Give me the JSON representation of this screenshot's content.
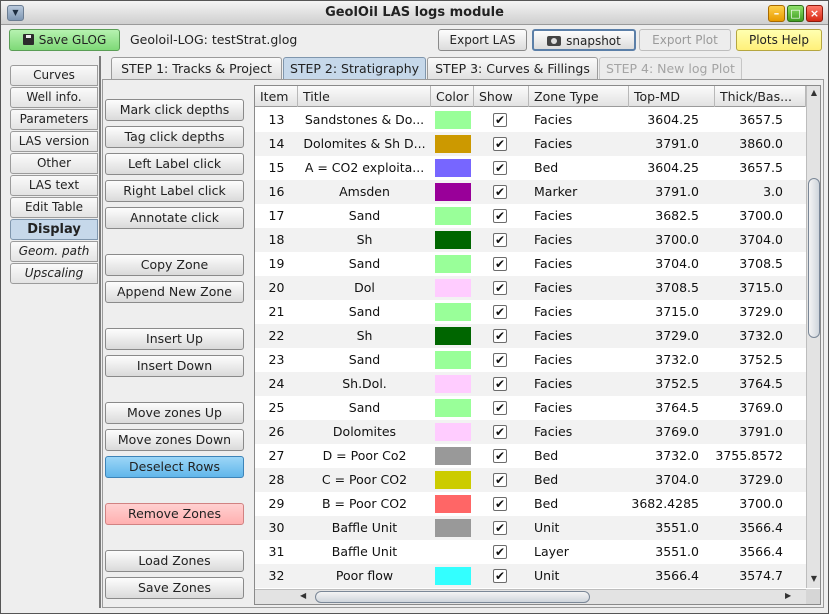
{
  "window": {
    "title": "GeolOil LAS logs module"
  },
  "toolbar": {
    "save_glog": "Save GLOG",
    "file_label": "Geoloil-LOG: testStrat.glog",
    "export_las": "Export LAS",
    "snapshot": "snapshot",
    "export_plot": "Export Plot",
    "plots_help": "Plots Help"
  },
  "side_tabs": [
    {
      "label": "Curves"
    },
    {
      "label": "Well info."
    },
    {
      "label": "Parameters"
    },
    {
      "label": "LAS version"
    },
    {
      "label": "Other"
    },
    {
      "label": "LAS text"
    },
    {
      "label": "Edit Table"
    },
    {
      "label": "Display",
      "active": true
    },
    {
      "label": "Geom. path",
      "italic": true
    },
    {
      "label": "Upscaling",
      "italic": true
    }
  ],
  "top_tabs": [
    {
      "label": "STEP 1: Tracks & Project"
    },
    {
      "label": "STEP 2: Stratigraphy",
      "active": true
    },
    {
      "label": "STEP 3: Curves & Fillings"
    },
    {
      "label": "STEP 4: New log Plot",
      "disabled": true
    }
  ],
  "actions": {
    "mark_click_depths": "Mark click depths",
    "tag_click_depths": "Tag click depths",
    "left_label_click": "Left Label click",
    "right_label_click": "Right Label click",
    "annotate_click": "Annotate click",
    "copy_zone": "Copy Zone",
    "append_new_zone": "Append New Zone",
    "insert_up": "Insert Up",
    "insert_down": "Insert Down",
    "move_zones_up": "Move zones Up",
    "move_zones_down": "Move zones Down",
    "deselect_rows": "Deselect Rows",
    "remove_zones": "Remove Zones",
    "load_zones": "Load Zones",
    "save_zones": "Save Zones"
  },
  "table": {
    "columns": [
      "Item",
      "Title",
      "Color",
      "Show",
      "Zone Type",
      "Top-MD",
      "Thick/Bas..."
    ],
    "rows": [
      {
        "item": "13",
        "title": "Sandstones & Do...",
        "color": "#99ff99",
        "show": "✔",
        "type": "Facies",
        "top": "3604.25",
        "thick": "3657.5"
      },
      {
        "item": "14",
        "title": "Dolomites & Sh D...",
        "color": "#cc9900",
        "show": "✔",
        "type": "Facies",
        "top": "3791.0",
        "thick": "3860.0"
      },
      {
        "item": "15",
        "title": "A = CO2 exploita...",
        "color": "#7766ff",
        "show": "✔",
        "type": "Bed",
        "top": "3604.25",
        "thick": "3657.5"
      },
      {
        "item": "16",
        "title": "Amsden",
        "color": "#990099",
        "show": "✔",
        "type": "Marker",
        "top": "3791.0",
        "thick": "3.0"
      },
      {
        "item": "17",
        "title": "Sand",
        "color": "#99ff99",
        "show": "✔",
        "type": "Facies",
        "top": "3682.5",
        "thick": "3700.0"
      },
      {
        "item": "18",
        "title": "Sh",
        "color": "#006600",
        "show": "✔",
        "type": "Facies",
        "top": "3700.0",
        "thick": "3704.0"
      },
      {
        "item": "19",
        "title": "Sand",
        "color": "#99ff99",
        "show": "✔",
        "type": "Facies",
        "top": "3704.0",
        "thick": "3708.5"
      },
      {
        "item": "20",
        "title": "Dol",
        "color": "#ffccff",
        "show": "✔",
        "type": "Facies",
        "top": "3708.5",
        "thick": "3715.0"
      },
      {
        "item": "21",
        "title": "Sand",
        "color": "#99ff99",
        "show": "✔",
        "type": "Facies",
        "top": "3715.0",
        "thick": "3729.0"
      },
      {
        "item": "22",
        "title": "Sh",
        "color": "#006600",
        "show": "✔",
        "type": "Facies",
        "top": "3729.0",
        "thick": "3732.0"
      },
      {
        "item": "23",
        "title": "Sand",
        "color": "#99ff99",
        "show": "✔",
        "type": "Facies",
        "top": "3732.0",
        "thick": "3752.5"
      },
      {
        "item": "24",
        "title": "Sh.Dol.",
        "color": "#ffccff",
        "show": "✔",
        "type": "Facies",
        "top": "3752.5",
        "thick": "3764.5"
      },
      {
        "item": "25",
        "title": "Sand",
        "color": "#99ff99",
        "show": "✔",
        "type": "Facies",
        "top": "3764.5",
        "thick": "3769.0"
      },
      {
        "item": "26",
        "title": "Dolomites",
        "color": "#ffccff",
        "show": "✔",
        "type": "Facies",
        "top": "3769.0",
        "thick": "3791.0"
      },
      {
        "item": "27",
        "title": "D = Poor Co2",
        "color": "#999999",
        "show": "✔",
        "type": "Bed",
        "top": "3732.0",
        "thick": "3755.8572"
      },
      {
        "item": "28",
        "title": "C = Poor CO2",
        "color": "#cccc00",
        "show": "✔",
        "type": "Bed",
        "top": "3704.0",
        "thick": "3729.0"
      },
      {
        "item": "29",
        "title": "B = Poor CO2",
        "color": "#ff6666",
        "show": "✔",
        "type": "Bed",
        "top": "3682.4285",
        "thick": "3700.0"
      },
      {
        "item": "30",
        "title": "Baffle Unit",
        "color": "#999999",
        "show": "✔",
        "type": "Unit",
        "top": "3551.0",
        "thick": "3566.4"
      },
      {
        "item": "31",
        "title": "Baffle Unit",
        "color": "",
        "show": "✔",
        "type": "Layer",
        "top": "3551.0",
        "thick": "3566.4"
      },
      {
        "item": "32",
        "title": "Poor flow",
        "color": "#33ffff",
        "show": "✔",
        "type": "Unit",
        "top": "3566.4",
        "thick": "3574.7"
      }
    ]
  }
}
